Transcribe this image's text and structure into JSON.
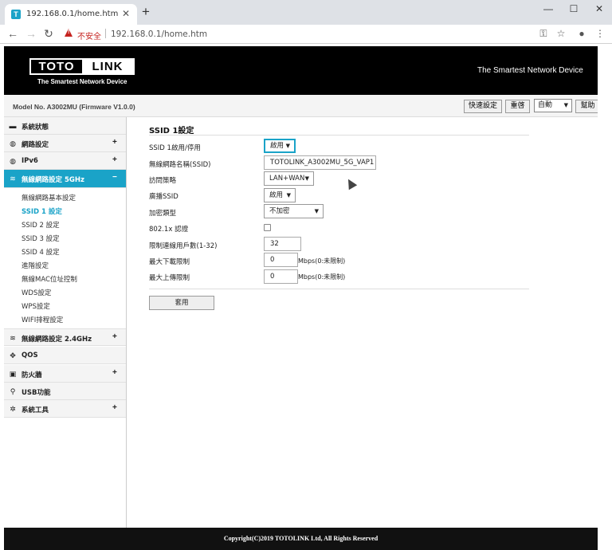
{
  "browser": {
    "tab_title": "192.168.0.1/home.htm",
    "tab_favicon": "T",
    "insecure_label": "不安全",
    "url": "192.168.0.1/home.htm"
  },
  "header": {
    "logo_left": "TOTO",
    "logo_right": "LINK",
    "logo_sub": "The Smartest Network Device",
    "slogan": "The Smartest Network Device"
  },
  "modelbar": {
    "model": "Model No. A3002MU (Firmware V1.0.0)",
    "quick_setup": "快速設定",
    "reboot": "重啓",
    "language": "自動",
    "help": "幫助"
  },
  "sidebar": {
    "items": [
      {
        "label": "系統狀態",
        "icon": "chat-icon"
      },
      {
        "label": "網路設定",
        "icon": "globe-icon",
        "expand": "+"
      },
      {
        "label": "IPv6",
        "icon": "globe-icon",
        "expand": "+"
      },
      {
        "label": "無線網路設定 5GHz",
        "icon": "wifi-icon",
        "expand": "−"
      },
      {
        "label": "無線網路設定 2.4GHz",
        "icon": "wifi-icon",
        "expand": "+"
      },
      {
        "label": "QOS",
        "icon": "qos-icon"
      },
      {
        "label": "防火牆",
        "icon": "lock-icon",
        "expand": "+"
      },
      {
        "label": "USB功能",
        "icon": "usb-icon"
      },
      {
        "label": "系統工具",
        "icon": "gear-icon",
        "expand": "+"
      }
    ],
    "sub_items": [
      "無線網路基本設定",
      "SSID 1 設定",
      "SSID 2 設定",
      "SSID 3 設定",
      "SSID 4 設定",
      "進階設定",
      "無線MAC位址控制",
      "WDS設定",
      "WPS設定",
      "WIFI排程設定"
    ]
  },
  "main": {
    "title": "SSID 1設定",
    "rows": {
      "enable_label": "SSID 1啟用/停用",
      "enable_value": "啟用",
      "ssid_label": "無線網路名稱(SSID)",
      "ssid_value": "TOTOLINK_A3002MU_5G_VAP1",
      "access_label": "訪問策略",
      "access_value": "LAN+WAN",
      "broadcast_label": "廣播SSID",
      "broadcast_value": "啟用",
      "encrypt_label": "加密類型",
      "encrypt_value": "不加密",
      "auth_label": "802.1x 認證",
      "max_clients_label": "限制連線用戶數(1-32)",
      "max_clients_value": "32",
      "down_label": "最大下載限制",
      "down_value": "0",
      "down_unit": "Mbps(0:未限制)",
      "up_label": "最大上傳限制",
      "up_value": "0",
      "up_unit": "Mbps(0:未限制)"
    },
    "apply": "套用"
  },
  "footer": {
    "copyright": "Copyright(C)2019 TOTOLINK Ltd, All Rights Reserved"
  },
  "colors": {
    "accent": "#1aa3c8",
    "header_bg": "#000000",
    "footer_bg": "#111111"
  }
}
